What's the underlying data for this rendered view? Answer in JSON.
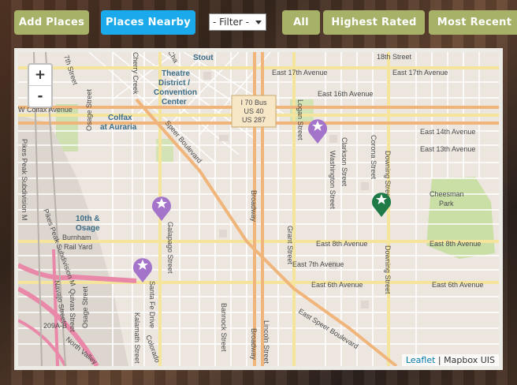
{
  "toolbar": {
    "add_places": "Add Places",
    "places_nearby": "Places Nearby",
    "filter_value": "- Filter -",
    "all": "All",
    "highest_rated": "Highest Rated",
    "most_recent": "Most Recent"
  },
  "colors": {
    "olive_button": "#a7b168",
    "blue_button": "#1aa9ea",
    "purple_marker": "#a374c9",
    "green_marker": "#1f7a47"
  },
  "map": {
    "zoom_in": "+",
    "zoom_out": "-",
    "attribution_link": "Leaflet",
    "attribution_rest": "| Mapbox UIS",
    "shield": {
      "line1": "I 70 Bus",
      "line2": "US 40",
      "line3": "US 287"
    },
    "streets": {
      "e17th_a": "East 17th Avenue",
      "e17th_b": "East 17th Avenue",
      "e18th": "18th Street",
      "e16th": "East 16th Avenue",
      "e14th": "East 14th Avenue",
      "e13th": "East 13th Avenue",
      "e8th_a": "East 8th Avenue",
      "e8th_b": "East 8th Avenue",
      "e7th": "East 7th Avenue",
      "e6th_a": "East 6th Avenue",
      "e6th_b": "East 6th Avenue",
      "colfax": "W Colfax Avenue",
      "speer": "Speer Boulevard",
      "e_speer": "East Speer Boulevard",
      "seventh_st": "7th Street",
      "osage": "Osage Street",
      "osage2": "Osage Street",
      "galapago": "Galapago Street",
      "santa_fe": "Santa Fe Drive",
      "kalamath": "Kalamath Street",
      "bannock": "Bannock Street",
      "broadway": "Broadway",
      "broadway2": "Broadway",
      "lincoln": "Lincoln Street",
      "grant": "Grant Street",
      "logan": "Logan Street",
      "clarkson": "Clarkson Street",
      "washington": "Washington Street",
      "corona": "Corona Street",
      "downing": "Downing Street",
      "downing2": "Downing Street",
      "pikes_peak": "Pikes Peak Subdivision M",
      "pikes_peak2": "Pikes Peak Subdivision M",
      "quivas": "Quivas Street",
      "navajo": "Navajo Street",
      "north_valley": "North Valley",
      "colorado": "Colorado",
      "cherry": "Cherry Creek",
      "chi": "Cha",
      "f209": "209A-B"
    },
    "areas": {
      "stout": "Stout",
      "theatre1": "Theatre",
      "theatre2": "District /",
      "theatre3": "Convention",
      "theatre4": "Center",
      "auraria1": "Colfax",
      "auraria2": "at Auraria",
      "osage_st1": "10th &",
      "osage_st2": "Osage",
      "burnham1": "Burnham",
      "burnham2": "Rail Yard",
      "cheesman1": "Cheesman",
      "cheesman2": "Park"
    }
  }
}
